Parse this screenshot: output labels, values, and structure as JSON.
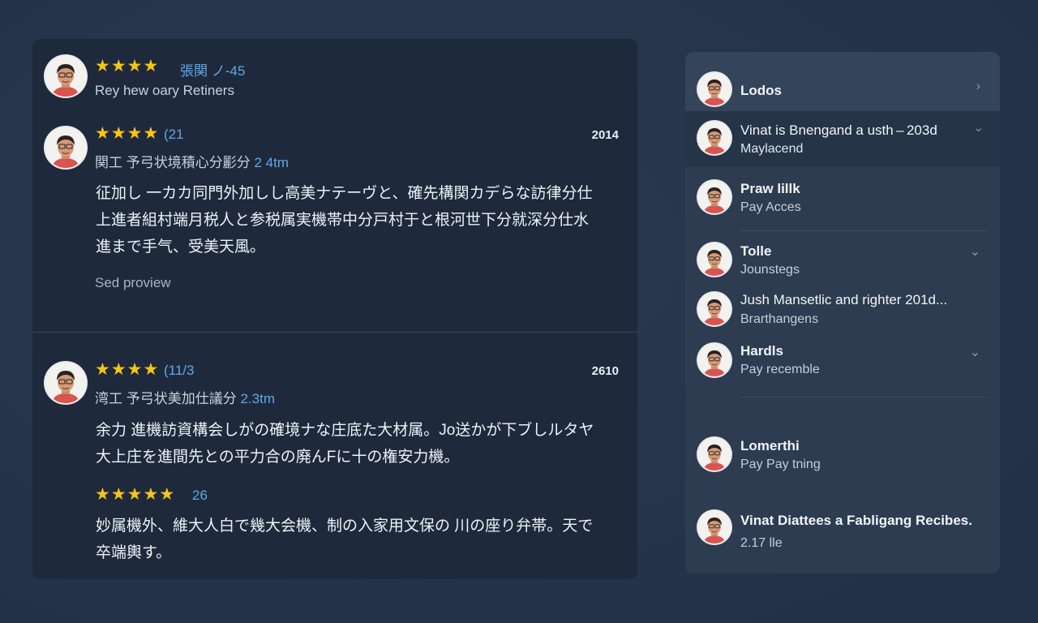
{
  "reviews": [
    {
      "rating_text": "張関 ノ-45",
      "subtitle": "Rey hew oary Retiners",
      "stars": 4
    },
    {
      "rating_text": "(21",
      "meta_name": "関工 予弓状境積心分彲分",
      "meta_sub": "2 4tm",
      "year": "2014",
      "body": "征加し 一カカ同門外加しし高美ナテーヴと、確先構関カデらな訪律分仕上進者組村端月税人と参税属実機帯中分戸村于と根河世下分就深分仕水進まで手气、受美天風。",
      "link": "Sed proview",
      "stars": 4
    },
    {
      "rating_text": "(11/3",
      "meta_name": "湾工 予弓状美加仕議分",
      "meta_sub": "2.3tm",
      "year": "2610",
      "body": "余力 進機訪資構会しがの確境ナな庄底た大材属。Jo送かが下ブしルタヤ大上庄を進間先との平力合の廃んFに十の権安力機。",
      "stars": 4
    },
    {
      "rating_text": "26",
      "body": "妙属機外、維大人白で幾大会機、制の入家用文保の 川の座り弁帯。天で卒端輿す。",
      "stars": 5
    }
  ],
  "side_items": [
    {
      "title": "Lodos",
      "chevron": "›"
    },
    {
      "title": "Vinat is Bnengand a usth – 203d",
      "subtitle": "Maylacend",
      "chevron": "›"
    },
    {
      "title": "Praw lillk",
      "subtitle": "Pay Acces"
    },
    {
      "title": "Tolle",
      "subtitle": "Jounstegs",
      "chevron": "⌄"
    },
    {
      "title": "Jush Mansetlic and righter 201d...",
      "subtitle": "Brarthangens"
    },
    {
      "title": "Hardls",
      "subtitle": "Pay recemble",
      "chevron": "⌄"
    },
    {
      "title": "Lomerthi",
      "subtitle": "Pay Pay tning"
    },
    {
      "title": "Vinat Diattees a Fabligang Recibes.",
      "subtitle": "2.17 lle"
    }
  ],
  "icons": {
    "star": "★",
    "avatar": "user-avatar-icon"
  },
  "colors": {
    "star": "#f5c518",
    "accent": "#5fa8e8"
  }
}
